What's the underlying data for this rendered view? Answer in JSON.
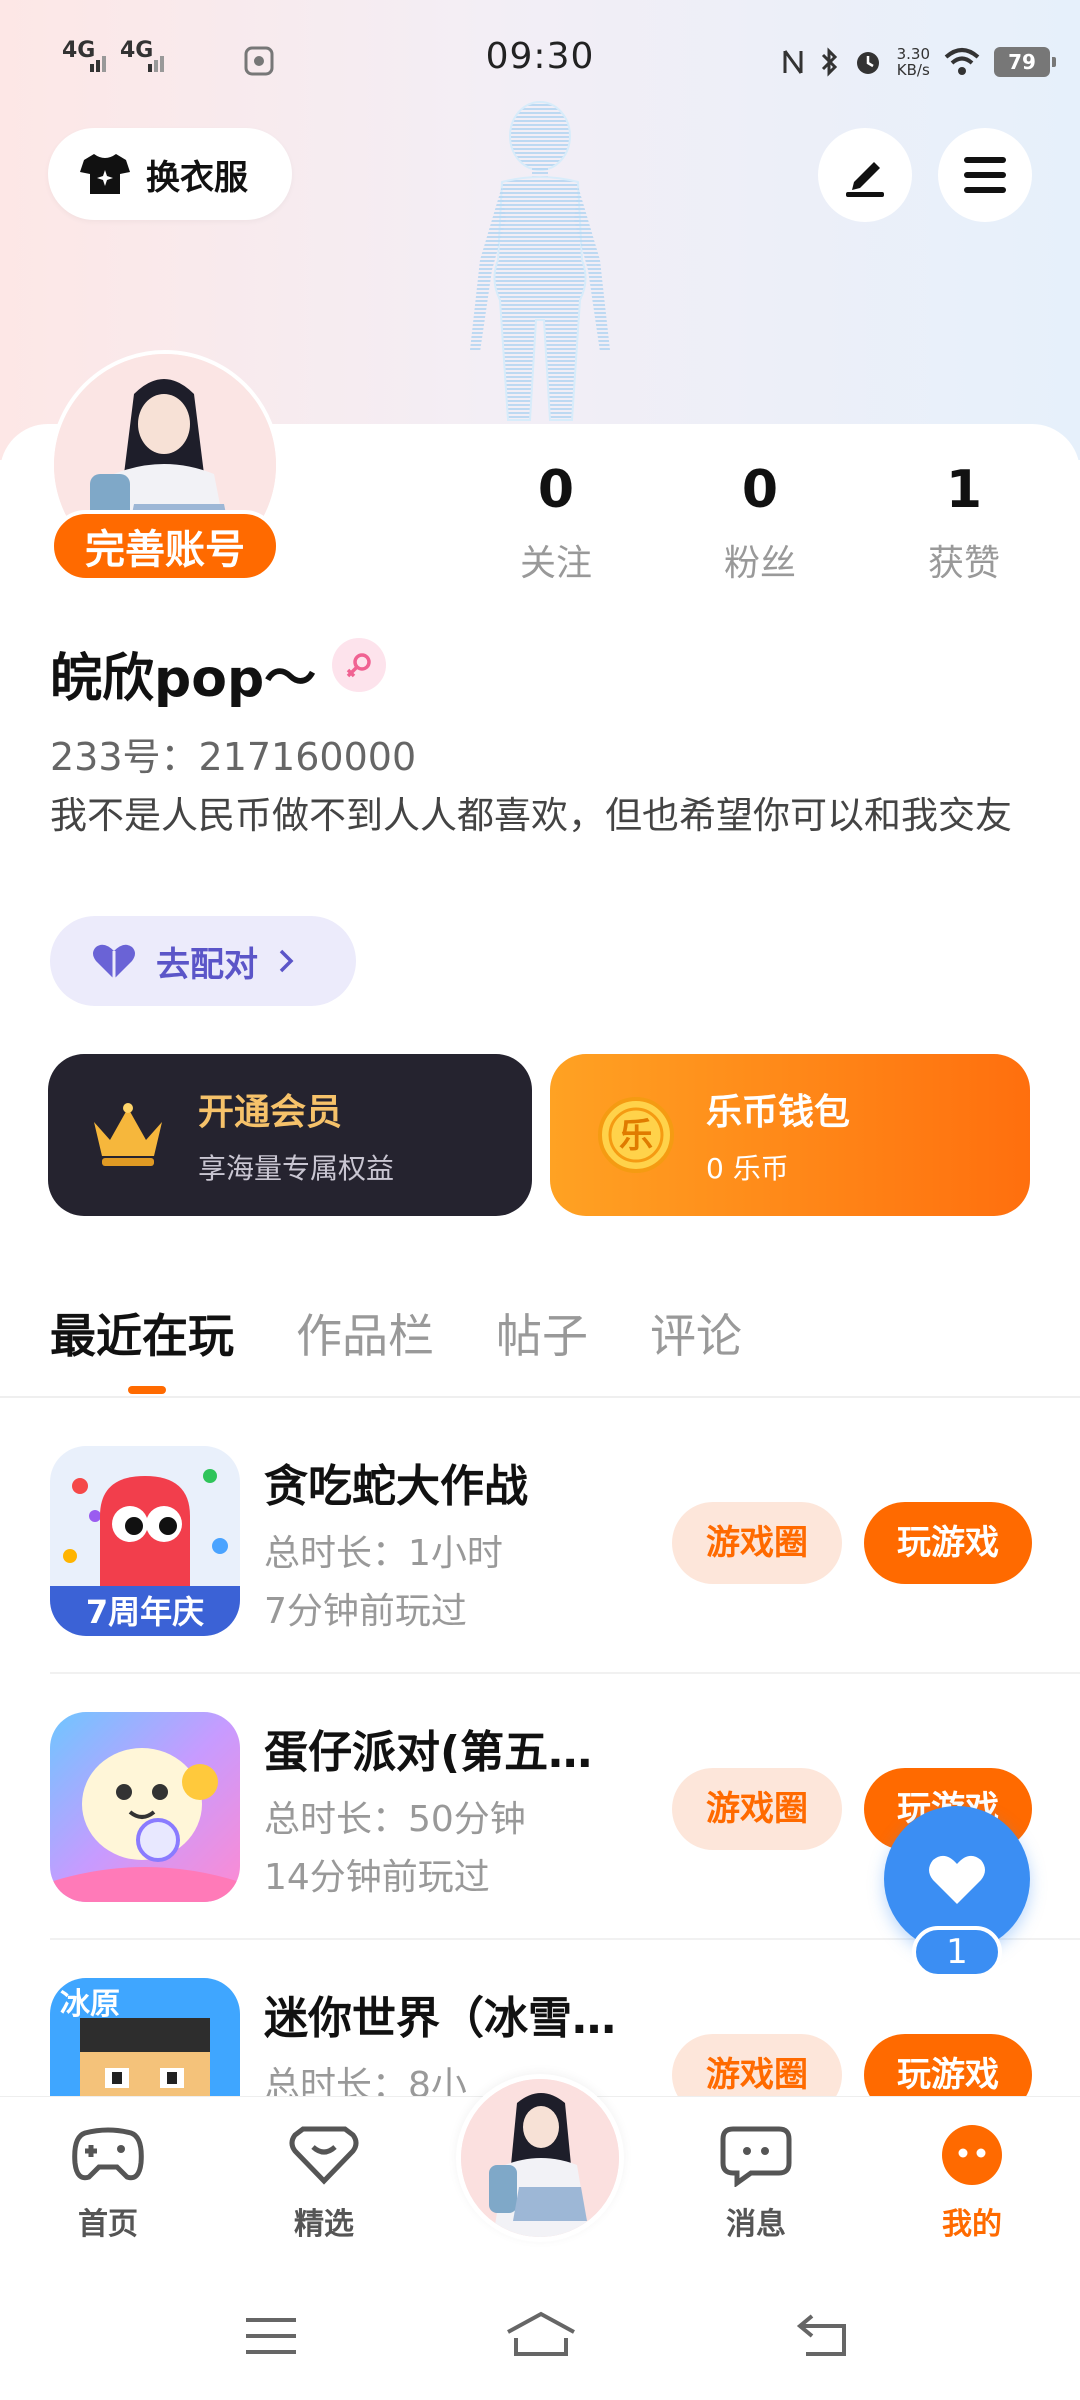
{
  "status_bar": {
    "network1": "4G",
    "network2": "4G",
    "time": "09:30",
    "speed_value": "3.30",
    "speed_unit": "KB/s",
    "battery": "79"
  },
  "top": {
    "dress_label": "换衣服"
  },
  "profile": {
    "complete_label": "完善账号",
    "stats": [
      {
        "value": "0",
        "label": "关注"
      },
      {
        "value": "0",
        "label": "粉丝"
      },
      {
        "value": "1",
        "label": "获赞"
      }
    ],
    "nickname": "皖欣pop～",
    "uid": "233号：217160000",
    "bio": "我不是人民币做不到人人都喜欢，但也希望你可以和我交友",
    "match_label": "去配对"
  },
  "cards": {
    "vip_title": "开通会员",
    "vip_sub": "享海量专属权益",
    "coin_symbol": "乐",
    "coin_title": "乐币钱包",
    "coin_sub": "0 乐币"
  },
  "tabs": [
    "最近在玩",
    "作品栏",
    "帖子",
    "评论"
  ],
  "games": [
    {
      "name": "贪吃蛇大作战",
      "duration": "总时长：1小时",
      "last_played": "7分钟前玩过",
      "circle_label": "游戏圈",
      "play_label": "玩游戏",
      "icon_text": "7周年庆"
    },
    {
      "name": "蛋仔派对(第五…",
      "duration": "总时长：50分钟",
      "last_played": "14分钟前玩过",
      "circle_label": "游戏圈",
      "play_label": "玩游戏",
      "icon_text": ""
    },
    {
      "name": "迷你世界（冰雪…",
      "duration": "总时长：8小",
      "last_played": "",
      "circle_label": "游戏圈",
      "play_label": "玩游戏",
      "icon_text": "冰原"
    }
  ],
  "fab": {
    "like_count": "1"
  },
  "bottom_nav": [
    {
      "label": "首页",
      "icon": "gamepad-icon"
    },
    {
      "label": "精选",
      "icon": "heart-gem-icon"
    },
    {
      "label": "消息",
      "icon": "chat-icon"
    },
    {
      "label": "我的",
      "icon": "profile-face-icon"
    }
  ],
  "colors": {
    "accent": "#ff6a00",
    "like_blue": "#3b8ef3",
    "vip_dark": "#25232f",
    "match_purple": "#5b55c8"
  }
}
